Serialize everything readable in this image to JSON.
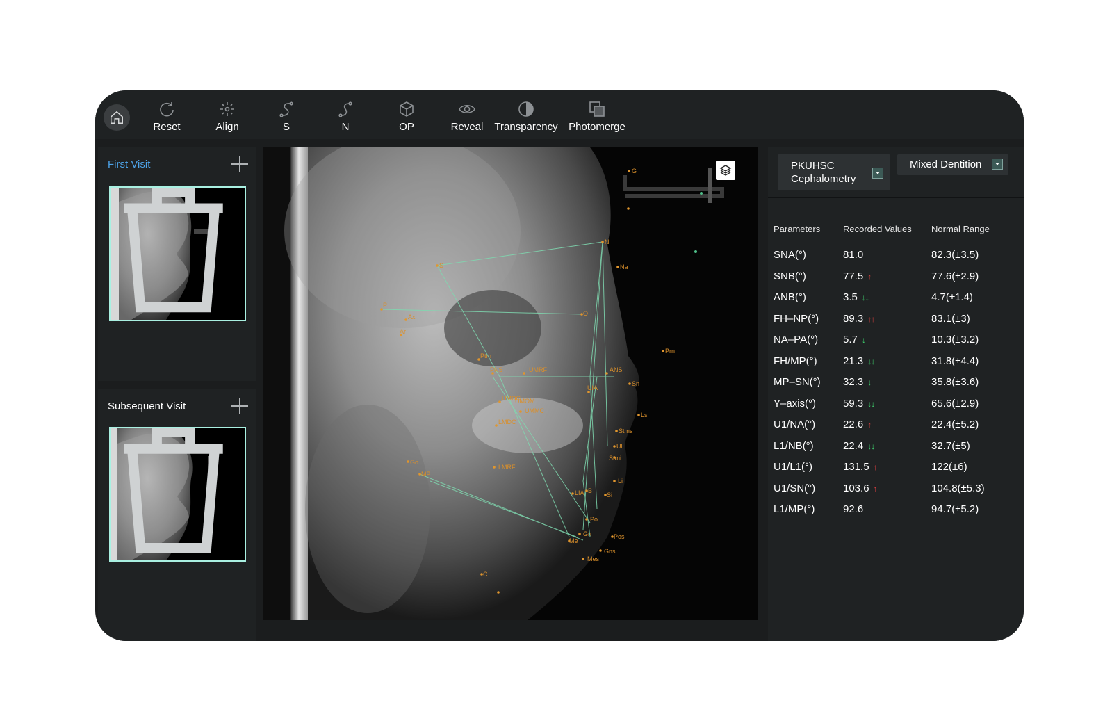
{
  "toolbar": {
    "items": [
      {
        "label": "Reset",
        "icon": "reset-icon"
      },
      {
        "label": "Align",
        "icon": "align-icon"
      },
      {
        "label": "S",
        "icon": "s-curve-icon"
      },
      {
        "label": "N",
        "icon": "n-curve-icon"
      },
      {
        "label": "OP",
        "icon": "cube-icon"
      },
      {
        "label": "Reveal",
        "icon": "eye-icon"
      },
      {
        "label": "Transparency",
        "icon": "half-circle-icon"
      },
      {
        "label": "Photomerge",
        "icon": "overlap-squares-icon"
      }
    ]
  },
  "visits": {
    "first": {
      "title": "First Visit"
    },
    "subsequent": {
      "title": "Subsequent Visit"
    }
  },
  "selectors": {
    "analysis": "PKUHSC Cephalometry",
    "dentition": "Mixed Dentition"
  },
  "table": {
    "headers": {
      "param": "Parameters",
      "value": "Recorded Values",
      "range": "Normal Range"
    },
    "rows": [
      {
        "param": "SNA(°)",
        "value": "81.0",
        "indicator": "",
        "range": "82.3(±3.5)"
      },
      {
        "param": "SNB(°)",
        "value": "77.5",
        "indicator": "up",
        "range": "77.6(±2.9)"
      },
      {
        "param": "ANB(°)",
        "value": "3.5",
        "indicator": "down2",
        "range": "4.7(±1.4)"
      },
      {
        "param": "FH–NP(°)",
        "value": "89.3",
        "indicator": "up2",
        "range": "83.1(±3)"
      },
      {
        "param": "NA–PA(°)",
        "value": "5.7",
        "indicator": "down",
        "range": "10.3(±3.2)"
      },
      {
        "param": "FH/MP(°)",
        "value": "21.3",
        "indicator": "down2",
        "range": "31.8(±4.4)"
      },
      {
        "param": "MP–SN(°)",
        "value": "32.3",
        "indicator": "down",
        "range": "35.8(±3.6)"
      },
      {
        "param": "Y–axis(°)",
        "value": "59.3",
        "indicator": "down2",
        "range": "65.6(±2.9)"
      },
      {
        "param": "U1/NA(°)",
        "value": "22.6",
        "indicator": "up",
        "range": "22.4(±5.2)"
      },
      {
        "param": "L1/NB(°)",
        "value": "22.4",
        "indicator": "down2",
        "range": "32.7(±5)"
      },
      {
        "param": "U1/L1(°)",
        "value": "131.5",
        "indicator": "up",
        "range": "122(±6)"
      },
      {
        "param": "U1/SN(°)",
        "value": "103.6",
        "indicator": "up",
        "range": "104.8(±5.3)"
      },
      {
        "param": "L1/MP(°)",
        "value": "92.6",
        "indicator": "",
        "range": "94.7(±5.2)"
      }
    ]
  },
  "landmarks": [
    {
      "label": "G"
    },
    {
      "label": "N"
    },
    {
      "label": "Na"
    },
    {
      "label": "S"
    },
    {
      "label": "P"
    },
    {
      "label": "Ax"
    },
    {
      "label": "Ar"
    },
    {
      "label": "O"
    },
    {
      "label": "Ptm"
    },
    {
      "label": "PNS"
    },
    {
      "label": "UMRF"
    },
    {
      "label": "ANS"
    },
    {
      "label": "Sn"
    },
    {
      "label": "UMDC"
    },
    {
      "label": "UMOM"
    },
    {
      "label": "UMMC"
    },
    {
      "label": "UIA"
    },
    {
      "label": "LMDC"
    },
    {
      "label": "Prn"
    },
    {
      "label": "Ls"
    },
    {
      "label": "Stms"
    },
    {
      "label": "Ul"
    },
    {
      "label": "Stmi"
    },
    {
      "label": "Go"
    },
    {
      "label": "MP"
    },
    {
      "label": "LMRF"
    },
    {
      "label": "Li"
    },
    {
      "label": "LIA"
    },
    {
      "label": "B"
    },
    {
      "label": "Si"
    },
    {
      "label": "Po"
    },
    {
      "label": "Gn"
    },
    {
      "label": "Me"
    },
    {
      "label": "Pos"
    },
    {
      "label": "Gns"
    },
    {
      "label": "Mes"
    },
    {
      "label": "C"
    }
  ],
  "colors": {
    "accent": "#4da3e8",
    "thumb_border": "#a9f0e1",
    "tracing": "#7fd9b0",
    "landmark": "#e0962e",
    "increase": "#e04040",
    "decrease": "#3fd36e"
  }
}
